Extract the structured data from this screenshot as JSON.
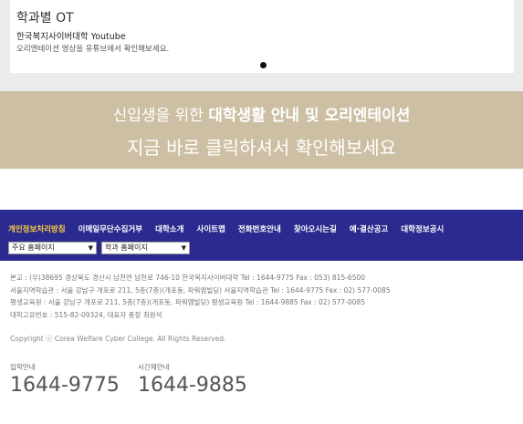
{
  "ot_card": {
    "title": "학과별 OT",
    "subtitle": "한국복지사이버대학 Youtube",
    "description": "오리엔테이션 영상을 유튜브에서 확인해보세요."
  },
  "banner": {
    "line1_prefix": "신입생을 위한 ",
    "line1_bold": "대학생활 안내 및 오리엔테이션",
    "line2": "지금 바로 클릭하셔서 확인해보세요"
  },
  "footer_nav": {
    "items": [
      "개인정보처리방침",
      "이메일무단수집거부",
      "대학소개",
      "사이트맵",
      "전화번호안내",
      "찾아오시는길",
      "예·결산공고",
      "대학정보공시"
    ]
  },
  "selects": {
    "main": "주요 홈페이지",
    "dept": "학과 홈페이지"
  },
  "footer": {
    "address_lines": [
      "본교 : (우)38695 경상북도 경산시 남천면 남천로 746-10 한국복지사이버대학 Tel : 1644-9775 Fax : 053) 815-6500",
      "서울지역학습관 : 서울 강남구 개포로 211, 5층(7층)(개포동, 파워엠빌딩) 서울지역학습관 Tel : 1644-9775 Fax : 02) 577-0085",
      "평생교육원 : 서울 강남구 개포로 211, 5층(7층)(개포동, 파워엠빌딩) 평생교육원 Tel : 1644-9885 Fax : 02) 577-0085",
      "대학고유번호 : 515-82-09324, 대표자 총장 최원석"
    ],
    "copyright": "Copyright ⓒ Corea Welfare Cyber College. All Rights Reserved.",
    "contact_a_label": "입학안내",
    "contact_a_number": "1644-9775",
    "contact_b_label": "시간제안내",
    "contact_b_number": "1644-9885"
  }
}
